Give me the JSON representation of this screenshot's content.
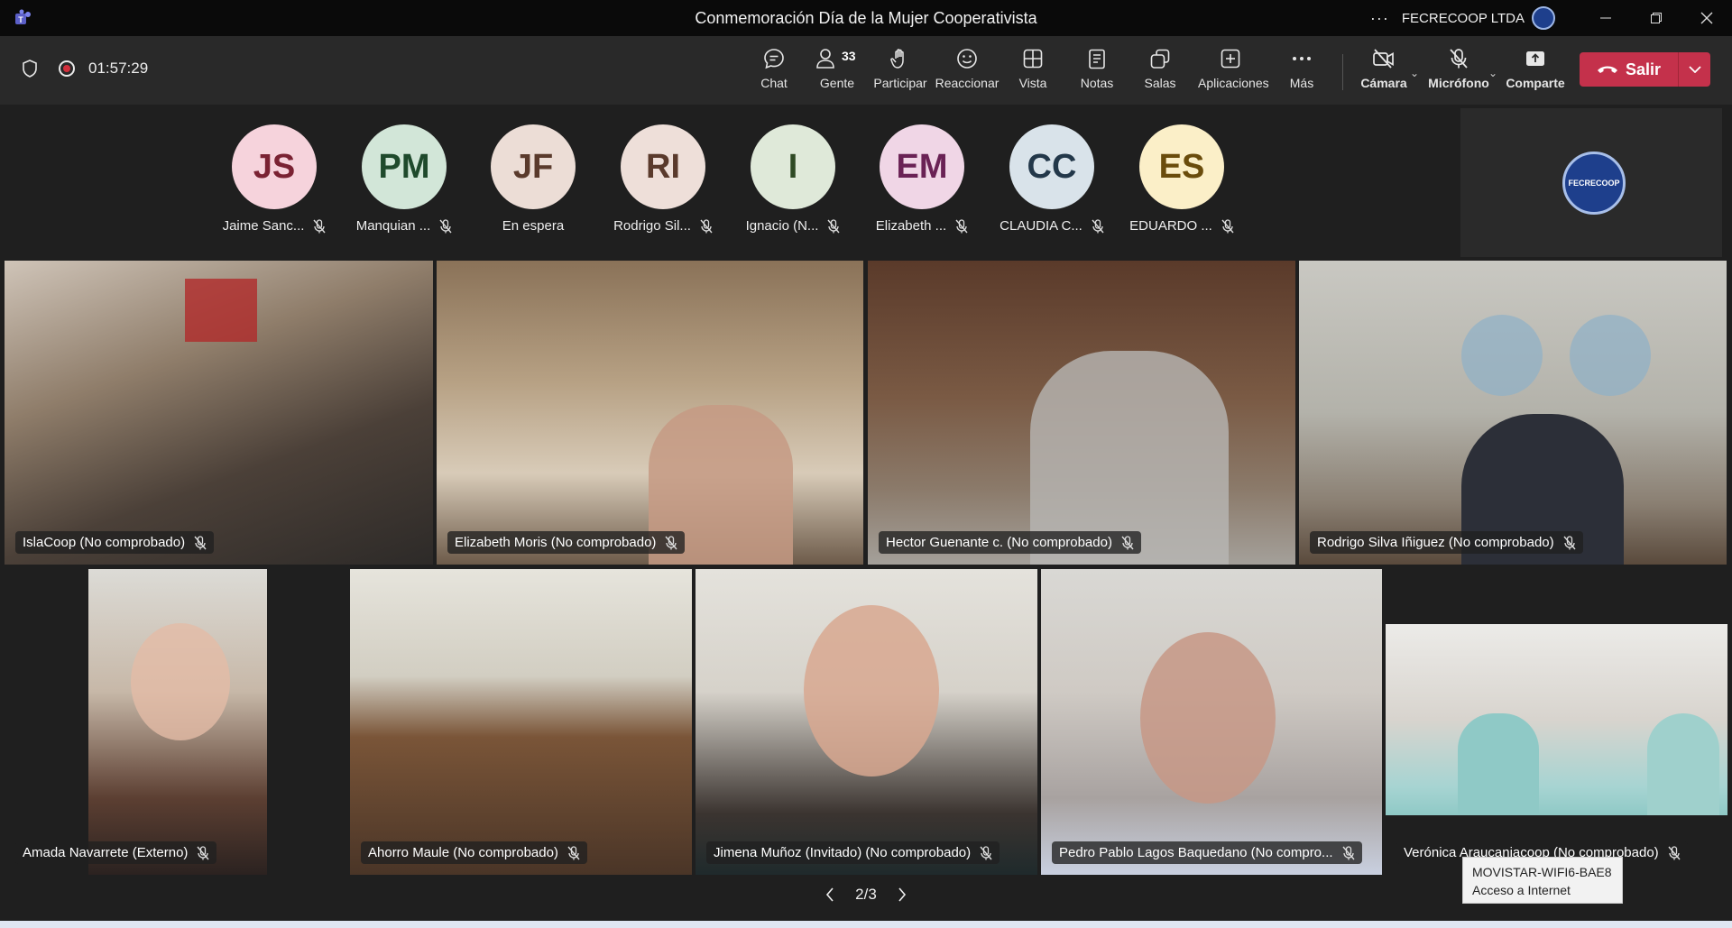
{
  "window": {
    "title": "Conmemoración Día de la Mujer Cooperativista",
    "org_name": "FECRECOOP LTDA"
  },
  "meeting": {
    "timer": "01:57:29"
  },
  "toolbar": {
    "chat": "Chat",
    "people": "Gente",
    "people_count": "33",
    "raise": "Participar",
    "react": "Reaccionar",
    "view": "Vista",
    "notes": "Notas",
    "rooms": "Salas",
    "apps": "Aplicaciones",
    "more": "Más",
    "camera": "Cámara",
    "mic": "Micrófono",
    "share": "Comparte",
    "leave": "Salir"
  },
  "participants_strip": [
    {
      "initials": "JS",
      "name": "Jaime Sanc...",
      "bg": "#f6d3dc",
      "fg": "#7a2233"
    },
    {
      "initials": "PM",
      "name": "Manquian ...",
      "bg": "#d2e6d8",
      "fg": "#1f4a2c"
    },
    {
      "initials": "JF",
      "name": "En espera",
      "bg": "#ecddd6",
      "fg": "#5a3a2c"
    },
    {
      "initials": "RI",
      "name": "Rodrigo Sil...",
      "bg": "#eedfd9",
      "fg": "#5a3a2c"
    },
    {
      "initials": "I",
      "name": "Ignacio (N...",
      "bg": "#dfe9d9",
      "fg": "#2f4a24"
    },
    {
      "initials": "EM",
      "name": "Elizabeth ...",
      "bg": "#f0d6e6",
      "fg": "#6a2255"
    },
    {
      "initials": "CC",
      "name": "CLAUDIA C...",
      "bg": "#d9e3ea",
      "fg": "#23384a"
    },
    {
      "initials": "ES",
      "name": "EDUARDO ...",
      "bg": "#fbefc8",
      "fg": "#6a4c0c"
    }
  ],
  "logo_panel": {
    "logo_text": "FECRECOOP"
  },
  "videos": [
    {
      "name": "IslaCoop (No comprobado)"
    },
    {
      "name": "Elizabeth Moris (No comprobado)"
    },
    {
      "name": "Hector Guenante c. (No comprobado)"
    },
    {
      "name": "Rodrigo Silva Iñiguez (No comprobado)"
    },
    {
      "name": "Amada Navarrete (Externo)"
    },
    {
      "name": "Ahorro Maule (No comprobado)"
    },
    {
      "name": "Jimena Muñoz (Invitado) (No comprobado)"
    },
    {
      "name": "Pedro Pablo Lagos Baquedano (No compro..."
    },
    {
      "name": "Verónica Araucaniacoop (No comprobado)"
    }
  ],
  "pager": {
    "label": "2/3"
  },
  "tooltip": {
    "line1": "MOVISTAR-WIFI6-BAE8",
    "line2": "Acceso a Internet"
  },
  "colors": {
    "leave": "#c4314b",
    "recording": "#d32f3c",
    "background": "#1f1f1f"
  }
}
